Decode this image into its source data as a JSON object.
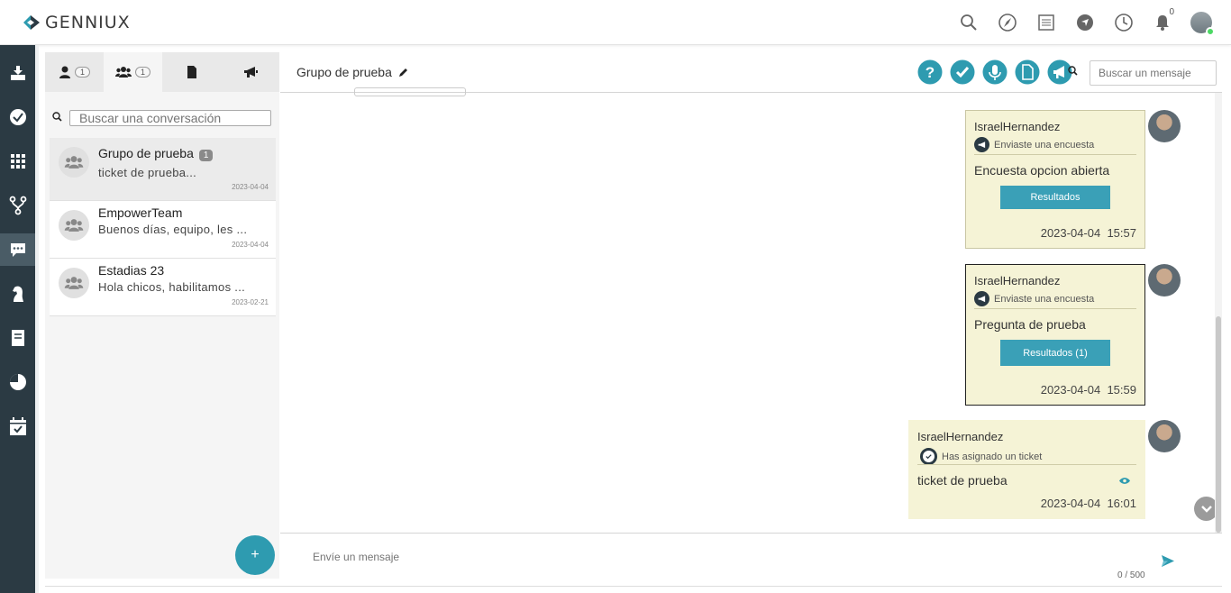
{
  "brand": {
    "name": "GENNIUX",
    "accent": "#2e9bb0",
    "sidebar_color": "#2b3a43",
    "bubble_color": "#f5f3d6"
  },
  "topbar": {
    "icons": [
      "search-icon",
      "compass-icon",
      "notes-icon",
      "navigate-icon",
      "clock-icon",
      "bell-icon"
    ],
    "bell_count": "0"
  },
  "left_nav": {
    "items": [
      "download-icon",
      "check-circle-icon",
      "grid-icon",
      "fork-icon",
      "chat-icon",
      "chess-knight-icon",
      "notebook-icon",
      "pie-chart-icon",
      "calendar-check-icon"
    ],
    "active": "chat-icon"
  },
  "side_panel": {
    "tabs": [
      {
        "icon": "user-icon",
        "count": "1"
      },
      {
        "icon": "users-icon",
        "count": "1"
      },
      {
        "icon": "file-icon",
        "count": ""
      },
      {
        "icon": "megaphone-icon",
        "count": ""
      }
    ],
    "search_placeholder": "Buscar una conversación",
    "conversations": [
      {
        "name": "Grupo de prueba",
        "badge": "1",
        "preview": "ticket de prueba...",
        "date": "2023-04-04"
      },
      {
        "name": "EmpowerTeam",
        "badge": "",
        "preview": "Buenos días, equipo, les ...",
        "date": "2023-04-04"
      },
      {
        "name": "Estadias 23",
        "badge": "",
        "preview": "Hola chicos, habilitamos ...",
        "date": "2023-02-21"
      }
    ],
    "fab_label": "+"
  },
  "chat": {
    "title": "Grupo de prueba",
    "header_actions": [
      "help-icon",
      "check-icon",
      "microphone-icon",
      "document-icon",
      "megaphone-icon"
    ],
    "search_placeholder": "Buscar un mensaje",
    "messages": [
      {
        "author": "IsraelHernandez",
        "sub": "Enviaste una encuesta",
        "text": "Encuesta opcion abierta",
        "button": "Resultados",
        "date": "2023-04-04",
        "time": "15:57"
      },
      {
        "author": "IsraelHernandez",
        "sub": "Enviaste una encuesta",
        "text": "Pregunta de prueba",
        "button": "Resultados (1)",
        "date": "2023-04-04",
        "time": "15:59"
      },
      {
        "author": "IsraelHernandez",
        "sub": "Has asignado un ticket",
        "text": "ticket de prueba",
        "button": "",
        "date": "2023-04-04",
        "time": "16:01"
      }
    ],
    "composer_placeholder": "Envíe un mensaje",
    "counter": "0 / 500"
  }
}
